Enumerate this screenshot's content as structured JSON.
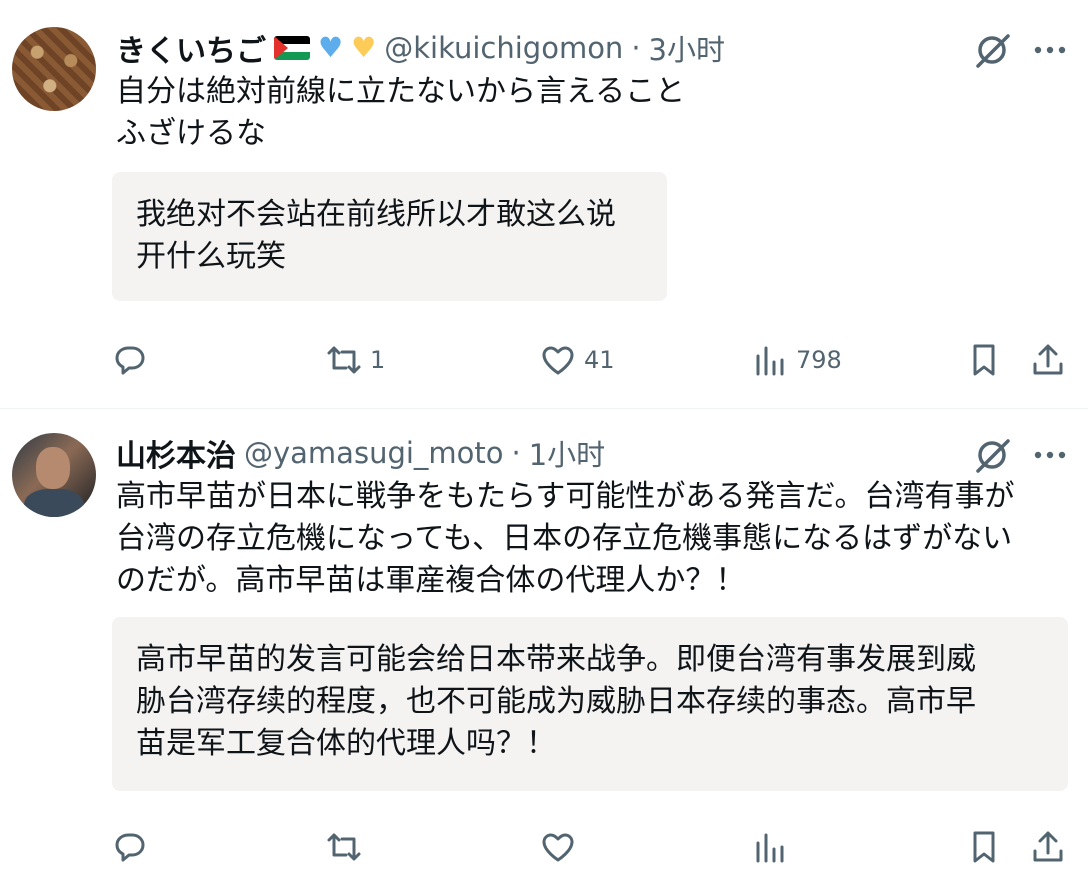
{
  "tweets": [
    {
      "display_name": "きくいちご",
      "handle": "@kikuichigomon",
      "separator": "·",
      "time": "3小时",
      "text": "自分は絶対前線に立たないから言えること\nふざけるな",
      "translation": "我绝对不会站在前线所以才敢这么说\n开什么玩笑",
      "actions": {
        "reply": "",
        "retweet": "1",
        "like": "41",
        "views": "798"
      }
    },
    {
      "display_name": "山杉本治",
      "handle": "@yamasugi_moto",
      "separator": "·",
      "time": "1小时",
      "text": "高市早苗が日本に戦争をもたらす可能性がある発言だ。台湾有事が\n台湾の存立危機になっても、日本の存立危機事態になるはずがない\nのだが。高市早苗は軍産複合体の代理人か？！",
      "translation": "高市早苗的发言可能会给日本带来战争。即便台湾有事发展到威\n胁台湾存续的程度，也不可能成为威胁日本存续的事态。高市早\n苗是军工复合体的代理人吗？！"
    }
  ],
  "colors": {
    "text": "#0f1419",
    "muted": "#536471",
    "translation_bg": "#f5f3f2",
    "divider": "#eff3f4"
  },
  "icons": [
    "grok-icon",
    "more-icon",
    "reply-icon",
    "retweet-icon",
    "like-icon",
    "views-icon",
    "bookmark-icon",
    "share-icon"
  ]
}
